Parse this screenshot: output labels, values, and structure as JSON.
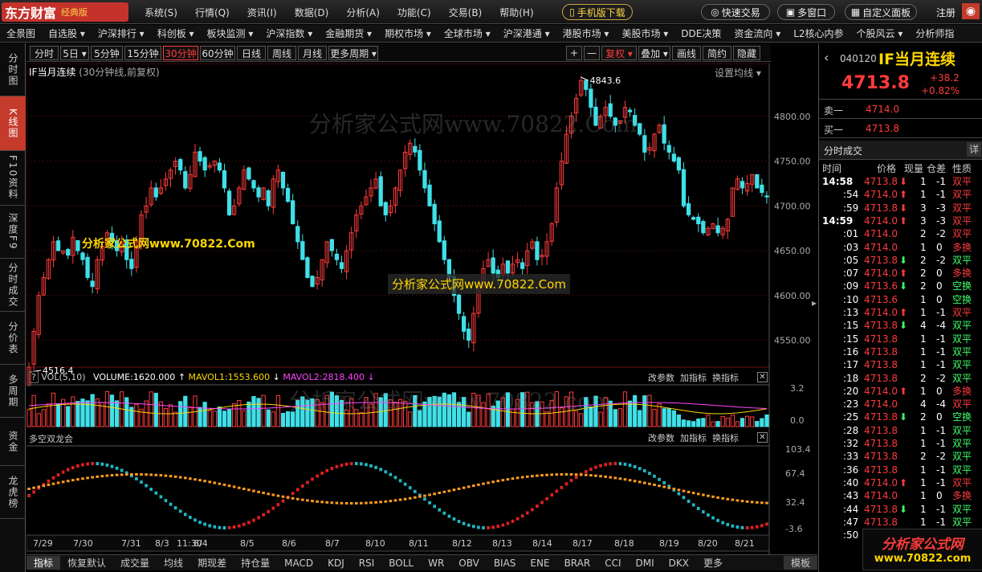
{
  "app": {
    "logo": "东方财富",
    "edition": "经典版",
    "mobile": "手机版下载",
    "quick_trade": "快速交易",
    "multi_window": "多窗口",
    "custom_panel": "自定义面板",
    "register": "注册"
  },
  "menus": [
    "系统(S)",
    "行情(Q)",
    "资讯(I)",
    "数据(D)",
    "分析(A)",
    "功能(C)",
    "交易(B)",
    "帮助(H)"
  ],
  "nav": [
    "全景图",
    "自选股 ▾",
    "沪深排行 ▾",
    "科创板 ▾",
    "板块监测 ▾",
    "沪深指数 ▾",
    "金融期货 ▾",
    "期权市场 ▾",
    "全球市场 ▾",
    "沪深港通 ▾",
    "港股市场 ▾",
    "美股市场 ▾",
    "DDE决策",
    "资金流向 ▾",
    "L2核心内参",
    "个股风云 ▾",
    "分析师指"
  ],
  "left_tabs": [
    "分时图",
    "K线图",
    "F10资料",
    "深度F9",
    "分时成交",
    "分价表",
    "多周期",
    "资金",
    "龙虎榜"
  ],
  "periods": [
    "分时",
    "5日 ▾",
    "5分钟",
    "15分钟",
    "30分钟",
    "60分钟",
    "日线",
    "周线",
    "月线",
    "更多周期 ▾"
  ],
  "active_period": "30分钟",
  "tools": [
    "+",
    "—",
    "复权 ▾",
    "叠加 ▾",
    "画线",
    "简约",
    "隐藏"
  ],
  "chart_title": "IF当月连续",
  "chart_sub": "(30分钟线,前复权)",
  "set_ma": "设置均线 ▾",
  "watermarks": {
    "top": "分析家公式网www.70822.Com",
    "left": "分析家公式网www.70822.Com",
    "mid": "分析家公式网www.70822.Com",
    "vol": "分析家公式网www.70822.com"
  },
  "vol_head": {
    "label": "VOL(5,10)",
    "volume": "VOLUME:1620.000",
    "ma1": "MAVOL1:1553.600",
    "ma2": "MAVOL2:2818.400"
  },
  "ind_head": {
    "label": "多空双龙会"
  },
  "section_btns": [
    "改参数",
    "加指标",
    "换指标"
  ],
  "bottom_tabs": [
    "指标",
    "恢复默认",
    "成交量",
    "均线",
    "期现差",
    "持仓量",
    "MACD",
    "KDJ",
    "RSI",
    "BOLL",
    "WR",
    "OBV",
    "BIAS",
    "ENE",
    "BRAR",
    "CCI",
    "DMI",
    "DKX",
    "更多"
  ],
  "template": "模板",
  "chart_data": {
    "type": "candlestick",
    "price_ylabels": [
      "4800.00",
      "4750.00",
      "4700.00",
      "4650.00",
      "4600.00",
      "4550.00"
    ],
    "ylim": [
      4520,
      4850
    ],
    "high_label": "4843.6",
    "low_label": "4516.4",
    "vol_ylabels": [
      "3.2",
      "0.0"
    ],
    "ind_ylabels": [
      "103.4",
      "67.4",
      "32.4",
      "-3.6"
    ],
    "xlabels": [
      "7/29",
      "7/30",
      "7/31",
      "8/3",
      "11:30",
      "8/4",
      "8/5",
      "8/6",
      "8/7",
      "8/10",
      "8/11",
      "8/12",
      "8/13",
      "8/14",
      "8/17",
      "8/18",
      "8/19",
      "8/20",
      "8/21"
    ],
    "close": [
      4520,
      4560,
      4600,
      4620,
      4640,
      4660,
      4650,
      4650,
      4645,
      4665,
      4650,
      4640,
      4620,
      4610,
      4640,
      4655,
      4670,
      4660,
      4650,
      4660,
      4640,
      4630,
      4660,
      4690,
      4700,
      4720,
      4710,
      4720,
      4730,
      4740,
      4750,
      4740,
      4720,
      4735,
      4760,
      4750,
      4740,
      4745,
      4750,
      4740,
      4720,
      4690,
      4700,
      4720,
      4740,
      4730,
      4720,
      4710,
      4720,
      4700,
      4730,
      4740,
      4720,
      4705,
      4680,
      4660,
      4640,
      4620,
      4610,
      4620,
      4640,
      4660,
      4650,
      4640,
      4630,
      4650,
      4670,
      4690,
      4700,
      4710,
      4720,
      4730,
      4700,
      4690,
      4700,
      4720,
      4740,
      4760,
      4770,
      4760,
      4740,
      4720,
      4700,
      4680,
      4660,
      4640,
      4620,
      4600,
      4580,
      4560,
      4550,
      4580,
      4610,
      4630,
      4640,
      4625,
      4620,
      4635,
      4625,
      4635,
      4640,
      4630,
      4650,
      4660,
      4640,
      4645,
      4660,
      4680,
      4720,
      4750,
      4780,
      4800,
      4820,
      4840,
      4830,
      4810,
      4790,
      4800,
      4810,
      4800,
      4790,
      4795,
      4810,
      4805,
      4790,
      4780,
      4760,
      4765,
      4780,
      4790,
      4770,
      4760,
      4750,
      4740,
      4700,
      4690,
      4685,
      4680,
      4670,
      4675,
      4680,
      4670,
      4675,
      4685,
      4720,
      4730,
      4720,
      4725,
      4735,
      4720,
      4715,
      4710
    ]
  },
  "quote": {
    "code": "040120",
    "name": "IF当月连续",
    "price": "4713.8",
    "change": "+38.2",
    "pct": "+0.82%",
    "sell_label": "卖一",
    "sell": "4714.0",
    "buy_label": "买一",
    "buy": "4713.8",
    "title": "分时成交",
    "detail": "详"
  },
  "trade_cols": [
    "时间",
    "价格",
    "现量",
    "仓差",
    "性质"
  ],
  "trades": [
    [
      "14:58",
      "4713.8",
      "⬇",
      "1",
      "-1",
      "双平",
      "r"
    ],
    [
      ":54",
      "4714.0",
      "⬆",
      "1",
      "-1",
      "双平",
      "r"
    ],
    [
      ":59",
      "4713.8",
      "⬇",
      "3",
      "-3",
      "双平",
      "r"
    ],
    [
      "14:59",
      "4714.0",
      "⬆",
      "3",
      "-3",
      "双平",
      "r"
    ],
    [
      ":01",
      "4714.0",
      "",
      "2",
      "-2",
      "双平",
      "r"
    ],
    [
      ":03",
      "4714.0",
      "",
      "1",
      "0",
      "多换",
      "r"
    ],
    [
      ":05",
      "4713.8",
      "⬇",
      "2",
      "-2",
      "双平",
      "g"
    ],
    [
      ":07",
      "4714.0",
      "⬆",
      "2",
      "0",
      "多换",
      "r"
    ],
    [
      ":09",
      "4713.6",
      "⬇",
      "2",
      "0",
      "空换",
      "g"
    ],
    [
      ":10",
      "4713.6",
      "",
      "1",
      "0",
      "空换",
      "g"
    ],
    [
      ":13",
      "4714.0",
      "⬆",
      "1",
      "-1",
      "双平",
      "r"
    ],
    [
      ":15",
      "4713.8",
      "⬇",
      "4",
      "-4",
      "双平",
      "g"
    ],
    [
      ":15",
      "4713.8",
      "",
      "1",
      "-1",
      "双平",
      "g"
    ],
    [
      ":16",
      "4713.8",
      "",
      "1",
      "-1",
      "双平",
      "g"
    ],
    [
      ":17",
      "4713.8",
      "",
      "1",
      "-1",
      "双平",
      "g"
    ],
    [
      ":18",
      "4713.8",
      "",
      "2",
      "-2",
      "双平",
      "g"
    ],
    [
      ":20",
      "4714.0",
      "⬆",
      "1",
      "0",
      "多换",
      "r"
    ],
    [
      ":23",
      "4714.0",
      "",
      "4",
      "-4",
      "双平",
      "r"
    ],
    [
      ":25",
      "4713.8",
      "⬇",
      "2",
      "0",
      "空换",
      "g"
    ],
    [
      ":28",
      "4713.8",
      "",
      "1",
      "-1",
      "双平",
      "g"
    ],
    [
      ":32",
      "4713.8",
      "",
      "1",
      "-1",
      "双平",
      "g"
    ],
    [
      ":33",
      "4713.8",
      "",
      "2",
      "-2",
      "双平",
      "g"
    ],
    [
      ":36",
      "4713.8",
      "",
      "1",
      "-1",
      "双平",
      "g"
    ],
    [
      ":40",
      "4714.0",
      "⬆",
      "1",
      "-1",
      "双平",
      "r"
    ],
    [
      ":43",
      "4714.0",
      "",
      "1",
      "0",
      "多换",
      "r"
    ],
    [
      ":44",
      "4713.8",
      "⬇",
      "1",
      "-1",
      "双平",
      "g"
    ],
    [
      ":47",
      "4713.8",
      "",
      "1",
      "-1",
      "双平",
      "g"
    ],
    [
      ":50",
      "4713.8",
      "",
      "1",
      "-1",
      "双平",
      "g"
    ]
  ],
  "badge": {
    "text": "分析家公式网",
    "url": "www.70822.com"
  },
  "colors": {
    "up": "#ff3b3b",
    "down": "#3fe0e8",
    "orange": "#ff9d1e",
    "yellow": "#ffd700",
    "magenta": "#ff44ff"
  }
}
